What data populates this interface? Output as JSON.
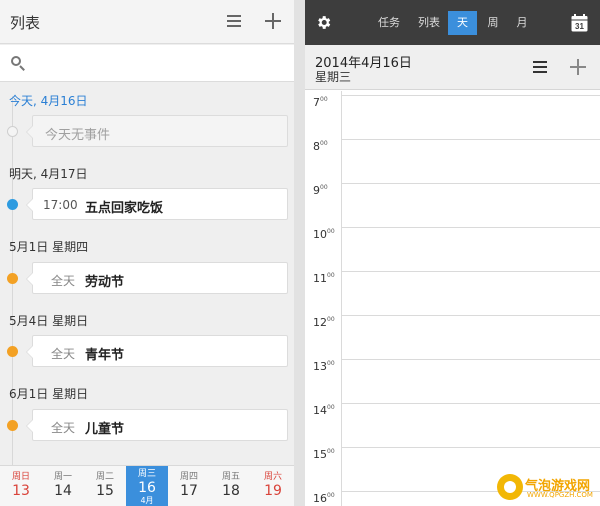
{
  "left_pane": {
    "header": {
      "title": "列表"
    },
    "search": {
      "placeholder": ""
    },
    "days": [
      {
        "header": "今天, 4月16日",
        "is_today": true,
        "events": [
          {
            "empty": true,
            "text": "今天无事件"
          }
        ]
      },
      {
        "header": "明天, 4月17日",
        "events": [
          {
            "time": "17:00",
            "title": "五点回家吃饭",
            "dot": "blue"
          }
        ]
      },
      {
        "header": "5月1日  星期四",
        "events": [
          {
            "time": "全天",
            "title": "劳动节",
            "dot": "orange"
          }
        ]
      },
      {
        "header": "5月4日  星期日",
        "events": [
          {
            "time": "全天",
            "title": "青年节",
            "dot": "orange"
          }
        ]
      },
      {
        "header": "6月1日  星期日",
        "events": [
          {
            "time": "全天",
            "title": "儿童节",
            "dot": "orange"
          }
        ]
      }
    ],
    "week_bar": {
      "days": [
        {
          "name": "周日",
          "num": "13",
          "weekend": true
        },
        {
          "name": "周一",
          "num": "14"
        },
        {
          "name": "周二",
          "num": "15"
        },
        {
          "name": "周三",
          "num": "16",
          "month": "4月",
          "selected": true
        },
        {
          "name": "周四",
          "num": "17"
        },
        {
          "name": "周五",
          "num": "18"
        },
        {
          "name": "周六",
          "num": "19",
          "weekend": true
        }
      ]
    }
  },
  "right_pane": {
    "tabs": [
      {
        "label": "任务"
      },
      {
        "label": "列表"
      },
      {
        "label": "天",
        "active": true
      },
      {
        "label": "周"
      },
      {
        "label": "月"
      }
    ],
    "calendar_icon_day": "31",
    "date_title": "2014年4月16日",
    "weekday": "星期三",
    "hours": [
      {
        "hour": "7",
        "mins": "00"
      },
      {
        "hour": "8",
        "mins": "00"
      },
      {
        "hour": "9",
        "mins": "00"
      },
      {
        "hour": "10",
        "mins": "00"
      },
      {
        "hour": "11",
        "mins": "00"
      },
      {
        "hour": "12",
        "mins": "00"
      },
      {
        "hour": "13",
        "mins": "00"
      },
      {
        "hour": "14",
        "mins": "00"
      },
      {
        "hour": "15",
        "mins": "00"
      },
      {
        "hour": "16",
        "mins": "00"
      }
    ]
  },
  "watermark": {
    "text": "气泡游戏网",
    "sub": "WWW.QPGZH.COM"
  },
  "colors": {
    "accent": "#3b8fdc",
    "today": "#2a7fd4",
    "weekend": "#d9433a",
    "dot_blue": "#2d9be0",
    "dot_orange": "#f3a124",
    "topbar": "#3d3d3d"
  }
}
